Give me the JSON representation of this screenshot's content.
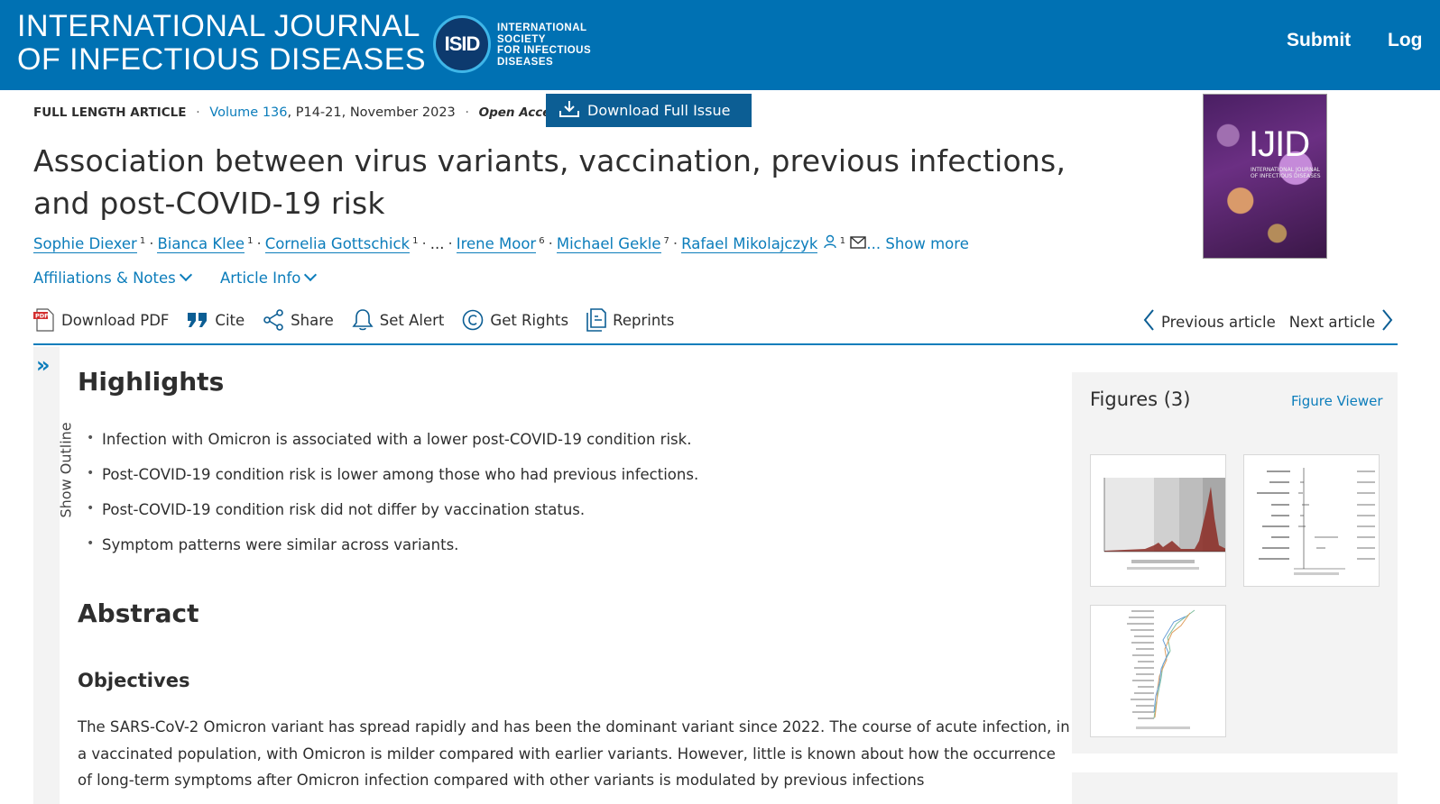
{
  "header": {
    "journal_line1": "INTERNATIONAL JOURNAL",
    "journal_line2": "OF INFECTIOUS DISEASES",
    "isid_logo": "ISID",
    "isid_line1": "INTERNATIONAL",
    "isid_line2": "SOCIETY",
    "isid_line3": "FOR INFECTIOUS",
    "isid_line4": "DISEASES",
    "submit": "Submit",
    "login": "Log",
    "bg_color": "#0071b3"
  },
  "meta": {
    "article_type": "FULL LENGTH ARTICLE",
    "volume_link": "Volume 136",
    "pages_date": ", P14-21, November 2023",
    "open_access": "Open Access",
    "download_issue": "Download Full Issue"
  },
  "article": {
    "title": "Association between virus variants, vaccination, previous infections, and post-COVID-19 risk",
    "cover_logo": "IJID",
    "cover_sub": "INTERNATIONAL JOURNAL OF INFECTIOUS DISEASES"
  },
  "authors": [
    {
      "name": "Sophie Diexer",
      "sup": "1"
    },
    {
      "name": "Bianca Klee",
      "sup": "1"
    },
    {
      "name": "Cornelia Gottschick",
      "sup": "1"
    },
    {
      "name": "Irene Moor",
      "sup": "6"
    },
    {
      "name": "Michael Gekle",
      "sup": "7"
    },
    {
      "name": "Rafael Mikolajczyk",
      "sup": "1"
    }
  ],
  "authors_misc": {
    "ellipsis": "...",
    "show_more": "... Show more"
  },
  "info_links": {
    "affiliations": "Affiliations & Notes",
    "article_info": "Article Info"
  },
  "toolbar": {
    "download_pdf": "Download PDF",
    "cite": "Cite",
    "share": "Share",
    "set_alert": "Set Alert",
    "get_rights": "Get Rights",
    "reprints": "Reprints",
    "previous": "Previous article",
    "next": "Next article"
  },
  "outline": {
    "label": "Show Outline"
  },
  "highlights": {
    "heading": "Highlights",
    "items": [
      "Infection with Omicron is associated with a lower post-COVID-19 condition risk.",
      "Post-COVID-19 condition risk is lower among those who had previous infections.",
      "Post-COVID-19 condition risk did not differ by vaccination status.",
      "Symptom patterns were similar across variants."
    ]
  },
  "abstract": {
    "heading": "Abstract",
    "objectives_heading": "Objectives",
    "objectives_text": "The SARS-CoV-2 Omicron variant has spread rapidly and has been the dominant variant since 2022. The course of acute infection, in a vaccinated population, with Omicron is milder compared with earlier variants. However, little is known about how the occurrence of long-term symptoms after Omicron infection compared with other variants is modulated by previous infections"
  },
  "figures": {
    "title": "Figures (3)",
    "viewer": "Figure Viewer"
  },
  "colors": {
    "link": "#0c7dbb",
    "accent_button": "#0c5e94",
    "panel_bg": "#f3f3f3"
  }
}
